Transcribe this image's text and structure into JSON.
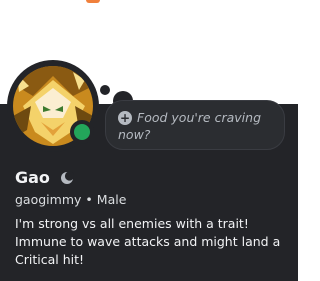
{
  "profile": {
    "display_name": "Gao",
    "username": "gaogimmy",
    "separator": "•",
    "pronouns": "Male",
    "bio": "I'm strong vs all enemies with a trait! Immune to wave attacks and might land a Critical hit!",
    "status": "online",
    "status_color": "#23a55a",
    "badge_icon": "moon-icon"
  },
  "custom_status": {
    "icon": "add-circle-icon",
    "placeholder": "Food you're craving now?"
  },
  "colors": {
    "card_background": "#232428",
    "banner_background": "#ffffff",
    "bubble_background": "#2b2d31"
  }
}
